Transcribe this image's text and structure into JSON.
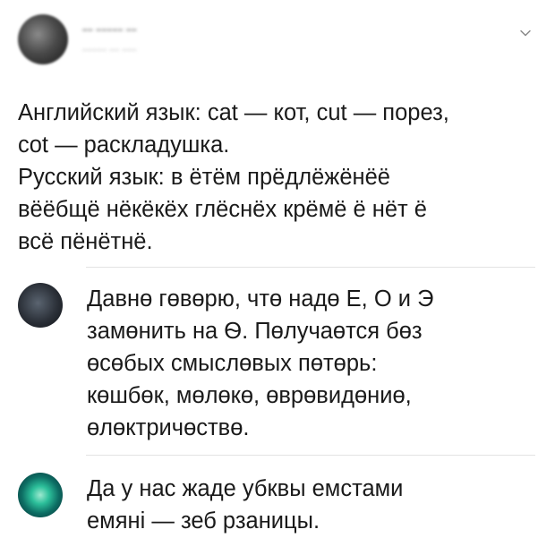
{
  "tweet": {
    "author_name": "–– ––––– ––",
    "author_handle": "––––– –– –––",
    "lines": [
      "Английский язык: cat — кот, cut — порез,",
      "cot — раскладушка.",
      "Русский язык: в ётём прёдлёжёнёё",
      "вёёбщё нёкёкёх глёснёх крёмё ё нёт ё",
      "всё пёнётнё."
    ]
  },
  "replies": [
    {
      "lines": [
        "Давнө гөвөрю, чтө надө Е, О и Э",
        "замөнить на Ѳ. Пөлучаөтся бөз",
        "өсөбых смыслөвых пөтөрь:",
        "көшбөк, мөлөкө, өврөвидөниө,",
        "өлөктричөствө."
      ]
    },
    {
      "lines": [
        "Да у нас жаде убквы емстами",
        "емяні — зеб рзаницы."
      ]
    }
  ],
  "icons": {
    "menu_chevron": "chevron-down-icon"
  },
  "colors": {
    "text": "#1a1a1a",
    "divider": "#e3e3e3",
    "chevron": "#8a8a8a"
  }
}
